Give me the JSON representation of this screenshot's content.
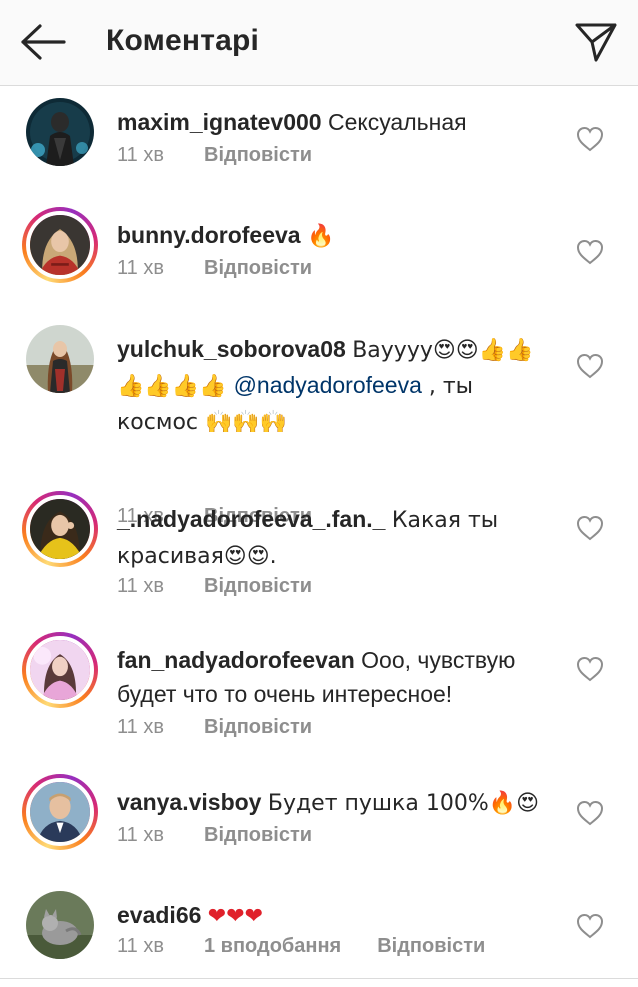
{
  "header": {
    "title": "Коментарі",
    "back_icon": "arrow-left-icon",
    "send_icon": "paper-plane-icon"
  },
  "comments": [
    {
      "username": "maxim_ignatev000",
      "text": "Сексуальная",
      "time": "11 хв",
      "likes": "",
      "reply": "Відповісти",
      "story_ring": false,
      "avatar": "avatar-dark-figure"
    },
    {
      "username": "bunny.dorofeeva",
      "text": "🔥",
      "time": "11 хв",
      "likes": "",
      "reply": "Відповісти",
      "story_ring": true,
      "avatar": "avatar-blonde-red"
    },
    {
      "username": "yulchuk_soborova08",
      "text_before": "Вауууу😍😍👍👍👍👍👍👍 ",
      "mention": "@nadyadorofeeva",
      "text_after": " , ты космос 🙌🙌🙌",
      "time": "11 хв",
      "likes": "",
      "reply": "Відповісти",
      "story_ring": false,
      "avatar": "avatar-girl-outdoor"
    },
    {
      "username": "_.nadyadorofeeva_.fan._",
      "text": "Какая ты красивая😍😍.",
      "time": "11 хв",
      "likes": "",
      "reply": "Відповісти",
      "story_ring": true,
      "avatar": "avatar-girl-yellow"
    },
    {
      "username": "fan_nadyadorofeevan",
      "text": "Ооо, чувствую будет что то очень интересное!",
      "time": "11 хв",
      "likes": "",
      "reply": "Відповісти",
      "story_ring": true,
      "avatar": "avatar-girl-pink"
    },
    {
      "username": "vanya.visboy",
      "text": "Будет пушка 100%🔥😍",
      "time": "11 хв",
      "likes": "",
      "reply": "Відповісти",
      "story_ring": true,
      "avatar": "avatar-boy-portrait"
    },
    {
      "username": "evadi66",
      "text": "❤❤❤",
      "time": "11 хв",
      "likes": "1 вподобання",
      "reply": "Відповісти",
      "story_ring": false,
      "avatar": "avatar-cat"
    }
  ],
  "colors": {
    "text": "#262626",
    "secondary": "#8e8e8e",
    "mention": "#003569",
    "header_bg": "#fafafa",
    "divider": "#dbdbdb"
  }
}
